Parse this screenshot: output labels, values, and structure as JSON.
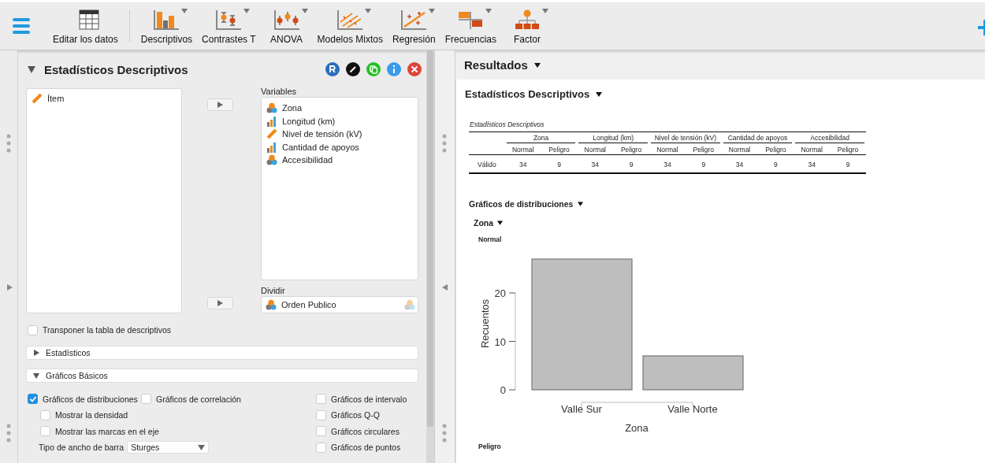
{
  "toolbar": {
    "items": [
      {
        "label": "Editar los datos",
        "kind": "table",
        "dropdown": false
      },
      {
        "label": "Descriptivos",
        "kind": "descriptives",
        "dropdown": true
      },
      {
        "label": "Contrastes T",
        "kind": "ttest",
        "dropdown": true
      },
      {
        "label": "ANOVA",
        "kind": "anova",
        "dropdown": true
      },
      {
        "label": "Modelos Mixtos",
        "kind": "mixed",
        "dropdown": true
      },
      {
        "label": "Regresión",
        "kind": "regression",
        "dropdown": true
      },
      {
        "label": "Frecuencias",
        "kind": "frequencies",
        "dropdown": true
      },
      {
        "label": "Factor",
        "kind": "factor",
        "dropdown": true
      }
    ]
  },
  "analysis": {
    "title": "Estadísticos Descriptivos",
    "expanded": true,
    "available": [
      {
        "name": "Ítem",
        "kind": "scale"
      }
    ],
    "variables": {
      "label": "Variables",
      "items": [
        {
          "name": "Zona",
          "kind": "nominal"
        },
        {
          "name": "Longitud (km)",
          "kind": "ordinal"
        },
        {
          "name": "Nivel de tensión (kV)",
          "kind": "scale"
        },
        {
          "name": "Cantidad de apoyos",
          "kind": "ordinal"
        },
        {
          "name": "Accesibilidad",
          "kind": "nominal"
        }
      ]
    },
    "split": {
      "label": "Dividir",
      "item": {
        "name": "Orden Publico",
        "kind": "nominal"
      }
    },
    "transpose": {
      "label": "Transponer la tabla de descriptivos",
      "checked": false
    },
    "sections": [
      {
        "label": "Estadísticos",
        "expanded": false
      },
      {
        "label": "Gráficos Básicos",
        "expanded": true
      }
    ],
    "plots": {
      "distribution": {
        "label": "Gráficos de distribuciones",
        "checked": true,
        "children": [
          {
            "label": "Mostrar la densidad",
            "checked": false
          },
          {
            "label": "Mostrar las marcas en el eje",
            "checked": false
          }
        ]
      },
      "correlation": {
        "label": "Gráficos de correlación",
        "checked": false
      },
      "bar_width": {
        "label": "Tipo de ancho de barra",
        "value": "Sturges"
      },
      "right": [
        {
          "label": "Gráficos de intervalo",
          "checked": false
        },
        {
          "label": "Gráficos Q-Q",
          "checked": false
        },
        {
          "label": "Gráficos circulares",
          "checked": false
        },
        {
          "label": "Gráficos de puntos",
          "checked": false
        }
      ]
    }
  },
  "results": {
    "title": "Resultados",
    "heading": "Estadísticos Descriptivos",
    "table": {
      "title": "Estadísticos Descriptivos",
      "groups": [
        {
          "label": "Zona",
          "subcolumns": [
            "Normal",
            "Peligro"
          ]
        },
        {
          "label": "Longitud (km)",
          "subcolumns": [
            "Normal",
            "Peligro"
          ]
        },
        {
          "label": "Nivel de tensión (kV)",
          "subcolumns": [
            "Normal",
            "Peligro"
          ]
        },
        {
          "label": "Cantidad de apoyos",
          "subcolumns": [
            "Normal",
            "Peligro"
          ]
        },
        {
          "label": "Accesibilidad",
          "subcolumns": [
            "Normal",
            "Peligro"
          ]
        }
      ],
      "rows": [
        {
          "label": "Válido",
          "values": [
            "34",
            "9",
            "34",
            "9",
            "34",
            "9",
            "34",
            "9",
            "34",
            "9"
          ]
        }
      ]
    },
    "plots_heading": "Gráficos de distribuciones",
    "variable_heading": "Zona",
    "panel_label": "Normal",
    "next_panel_label": "Peligro",
    "chart_data": {
      "type": "bar",
      "xlabel": "Zona",
      "ylabel": "Recuentos",
      "categories": [
        "Valle Sur",
        "Valle Norte"
      ],
      "values": [
        27,
        7
      ],
      "ylim": [
        0,
        27
      ],
      "yticks": [
        0,
        10,
        20
      ]
    }
  }
}
